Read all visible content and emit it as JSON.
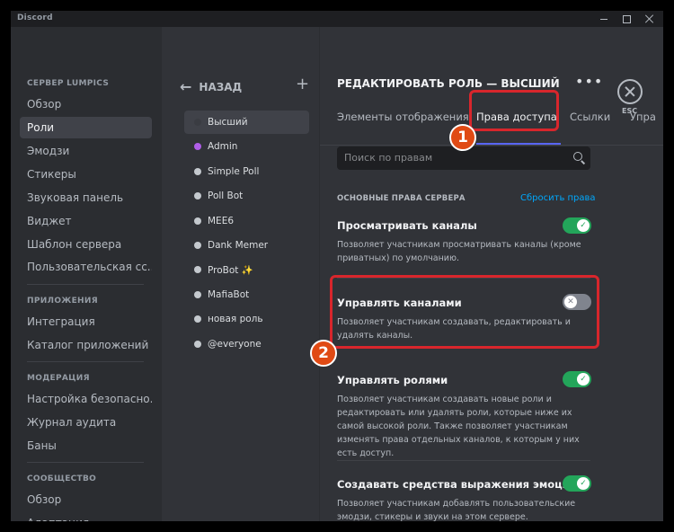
{
  "window": {
    "app_name": "Discord"
  },
  "sidebar": {
    "section1": "СЕРВЕР LUMPICS",
    "items1": [
      "Обзор",
      "Роли",
      "Эмодзи",
      "Стикеры",
      "Звуковая панель",
      "Виджет",
      "Шаблон сервера",
      "Пользовательская сс..."
    ],
    "section2": "ПРИЛОЖЕНИЯ",
    "items2": [
      "Интеграция",
      "Каталог приложений"
    ],
    "section3": "МОДЕРАЦИЯ",
    "items3": [
      "Настройка безопасно...",
      "Журнал аудита",
      "Баны"
    ],
    "section4": "СООБЩЕСТВО",
    "items4": [
      "Обзор",
      "Адаптация"
    ]
  },
  "roles_panel": {
    "back_label": "НАЗАД",
    "roles": [
      {
        "name": "Высший",
        "color": "#3a3c42"
      },
      {
        "name": "Admin",
        "color": "#b05ee8"
      },
      {
        "name": "Simple Poll",
        "color": "#c4c9ce"
      },
      {
        "name": "Poll Bot",
        "color": "#c4c9ce"
      },
      {
        "name": "MEE6",
        "color": "#c4c9ce"
      },
      {
        "name": "Dank Memer",
        "color": "#c4c9ce"
      },
      {
        "name": "ProBot ✨",
        "color": "#c4c9ce"
      },
      {
        "name": "MafiaBot",
        "color": "#c4c9ce"
      },
      {
        "name": "новая роль",
        "color": "#c4c9ce"
      },
      {
        "name": "@everyone",
        "color": "#c4c9ce"
      }
    ]
  },
  "editor": {
    "title": "РЕДАКТИРОВАТЬ РОЛЬ — ВЫСШИЙ",
    "more": "•••",
    "esc_label": "ESC",
    "tabs": [
      "Элементы отображения",
      "Права доступа",
      "Ссылки",
      "Упра"
    ],
    "search_placeholder": "Поиск по правам",
    "section_title": "ОСНОВНЫЕ ПРАВА СЕРВЕРА",
    "reset_label": "Сбросить права",
    "permissions": [
      {
        "title": "Просматривать каналы",
        "desc": "Позволяет участникам просматривать каналы (кроме приватных) по умолчанию.",
        "enabled": true
      },
      {
        "title": "Управлять каналами",
        "desc": "Позволяет участникам создавать, редактировать и удалять каналы.",
        "enabled": false
      },
      {
        "title": "Управлять ролями",
        "desc": "Позволяет участникам создавать новые роли и редактировать или удалять роли, которые ниже их самой высокой роли. Также позволяет участникам изменять права отдельных каналов, к которым у них есть доступ.",
        "enabled": true
      },
      {
        "title": "Создавать средства выражения эмоций",
        "desc": "Позволяет участникам добавлять пользовательские эмодзи, стикеры и звуки на этом сервере.",
        "enabled": true
      }
    ]
  },
  "annotations": {
    "badge1": "1",
    "badge2": "2",
    "color": "#d8262c"
  }
}
